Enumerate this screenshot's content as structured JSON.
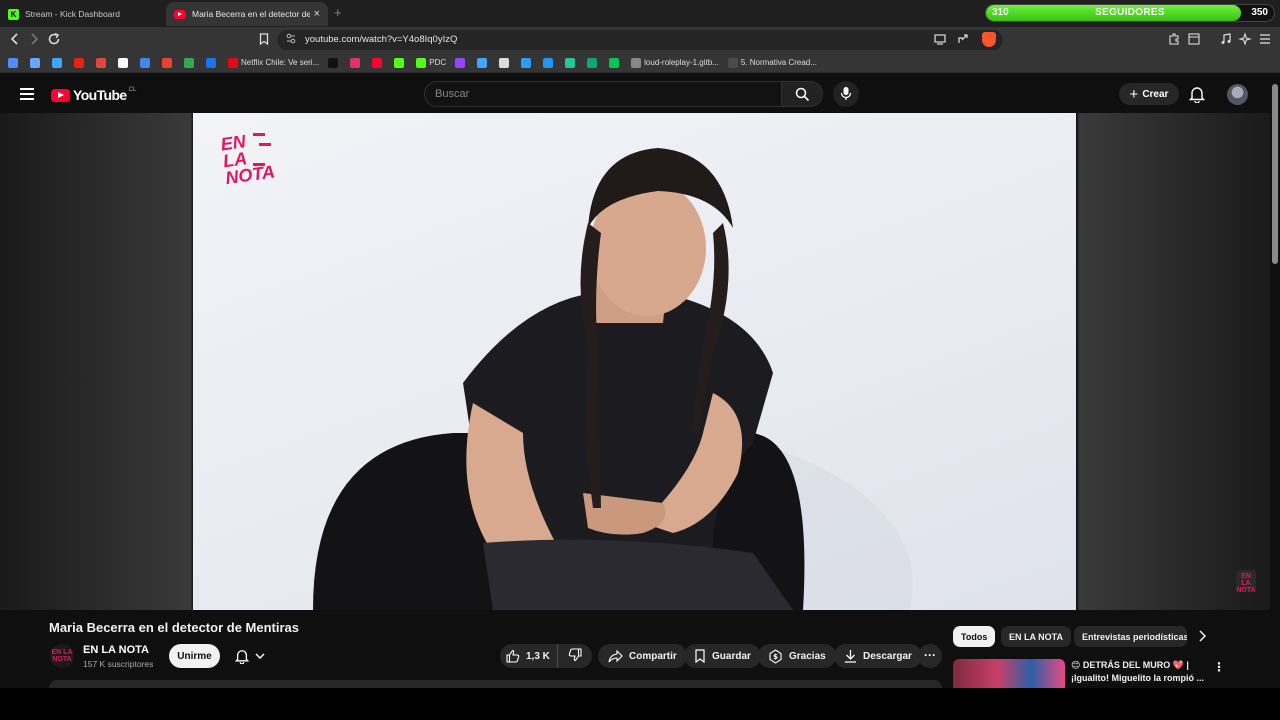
{
  "browser": {
    "tabs": [
      {
        "title": "Stream - Kick Dashboard",
        "icon": "kick-icon"
      },
      {
        "title": "Maria Becerra en el detector de",
        "icon": "youtube-icon"
      }
    ],
    "new_tab_glyph": "+",
    "close_glyph": "×",
    "url": "youtube.com/watch?v=Y4o8Iq0yIzQ",
    "bookmarks": [
      {
        "label": "",
        "color": "#4f8ef7"
      },
      {
        "label": "",
        "color": "#6aa6ff"
      },
      {
        "label": "",
        "color": "#3ea6ff"
      },
      {
        "label": "",
        "color": "#e62117"
      },
      {
        "label": "",
        "color": "#e2463f"
      },
      {
        "label": "",
        "color": "#ffffff"
      },
      {
        "label": "",
        "color": "#4285f4"
      },
      {
        "label": "",
        "color": "#ea4335"
      },
      {
        "label": "",
        "color": "#34a853"
      },
      {
        "label": "",
        "color": "#1a73e8"
      },
      {
        "label": "Netflix Chile: Ve seri...",
        "color": "#e50914"
      },
      {
        "label": "",
        "color": "#111111"
      },
      {
        "label": "",
        "color": "#e1306c"
      },
      {
        "label": "",
        "color": "#ff0033"
      },
      {
        "label": "",
        "color": "#53fc18"
      },
      {
        "label": "PDC",
        "color": "#53fc18"
      },
      {
        "label": "",
        "color": "#9146ff"
      },
      {
        "label": "",
        "color": "#3ea6ff"
      },
      {
        "label": "",
        "color": "#dddddd"
      },
      {
        "label": "",
        "color": "#2a9df4"
      },
      {
        "label": "",
        "color": "#2196f3"
      },
      {
        "label": "",
        "color": "#20c997"
      },
      {
        "label": "",
        "color": "#10a37f"
      },
      {
        "label": "",
        "color": "#00c853"
      },
      {
        "label": "loud-roleplay-1.gitb...",
        "color": "#888888"
      },
      {
        "label": "5. Normativa Cread...",
        "color": "#4a4a4a"
      }
    ]
  },
  "goal": {
    "current": "310",
    "label": "SEGUIDORES",
    "target": "350",
    "progress": 0.886
  },
  "youtube": {
    "logo_text": "YouTube",
    "country": "CL",
    "search_placeholder": "Buscar",
    "create_label": "Crear"
  },
  "video": {
    "overlay_logo": [
      "EN",
      "LA",
      "NOTA"
    ],
    "corner_logo": [
      "EN",
      "LA",
      "NOTA"
    ],
    "title": "Maria Becerra en el detector de Mentiras"
  },
  "channel": {
    "name": "EN LA NOTA",
    "subscribers": "157 K suscriptores",
    "join_label": "Unirme",
    "avatar_text": "EN LA NOTA"
  },
  "actions": {
    "likes": "1,3 K",
    "share": "Compartir",
    "save": "Guardar",
    "thanks": "Gracias",
    "download": "Descargar",
    "more": "···"
  },
  "sidebar": {
    "chips": [
      "Todos",
      "EN LA NOTA",
      "Entrevistas periodísticas"
    ],
    "rec": {
      "title_line1": "😊 DETRÁS DEL MURO 💖 |",
      "title_line2": "¡Igualito! Miguelito la rompió ..."
    }
  },
  "colors": {
    "youtube_red": "#ff0033",
    "brand_pink": "#e5165f",
    "goal_green": "#53fc18"
  }
}
